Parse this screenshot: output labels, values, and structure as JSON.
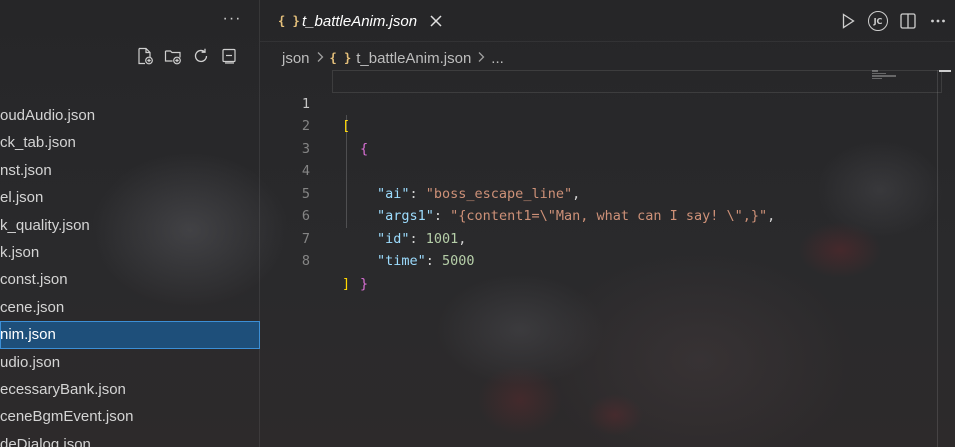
{
  "explorer": {
    "more_label": "···",
    "actions": [
      {
        "name": "new-file-icon"
      },
      {
        "name": "new-folder-icon"
      },
      {
        "name": "refresh-icon"
      },
      {
        "name": "collapse-all-icon"
      }
    ],
    "files": [
      {
        "label": "oudAudio.json",
        "selected": false
      },
      {
        "label": "ck_tab.json",
        "selected": false
      },
      {
        "label": "nst.json",
        "selected": false
      },
      {
        "label": "el.json",
        "selected": false
      },
      {
        "label": "k_quality.json",
        "selected": false
      },
      {
        "label": "k.json",
        "selected": false
      },
      {
        "label": "const.json",
        "selected": false
      },
      {
        "label": "cene.json",
        "selected": false
      },
      {
        "label": "nim.json",
        "selected": true
      },
      {
        "label": "udio.json",
        "selected": false
      },
      {
        "label": "ecessaryBank.json",
        "selected": false
      },
      {
        "label": "ceneBgmEvent.json",
        "selected": false
      },
      {
        "label": "deDialog.json",
        "selected": false
      }
    ]
  },
  "tab": {
    "icon_text": "{ }",
    "title": "t_battleAnim.json"
  },
  "editor_actions": {
    "avatar_initials": "JC"
  },
  "breadcrumb": {
    "folder": "json",
    "file_icon_text": "{ }",
    "file": "t_battleAnim.json",
    "ellipsis": "..."
  },
  "code": {
    "line_numbers": [
      "1",
      "2",
      "3",
      "4",
      "5",
      "6",
      "7",
      "8"
    ],
    "line1_bracket": "[",
    "line2_brace": "{",
    "k_ai": "\"ai\"",
    "v_ai": "\"boss_escape_line\"",
    "k_args1": "\"args1\"",
    "v_args1": "\"{content1=\\\"Man, what can I say! \\\",}\"",
    "k_id": "\"id\"",
    "v_id": "1001",
    "k_time": "\"time\"",
    "v_time": "5000",
    "line7_brace": "}",
    "line8_bracket": "]",
    "colon": ": ",
    "comma": ","
  },
  "colors": {
    "accent_selected": "#1e4f7a",
    "json_icon": "#e5c07b",
    "key": "#9cdcfe",
    "string": "#ce9178",
    "number": "#b5cea8",
    "bracket_level1": "#ffd700",
    "bracket_level2": "#da70d6"
  }
}
